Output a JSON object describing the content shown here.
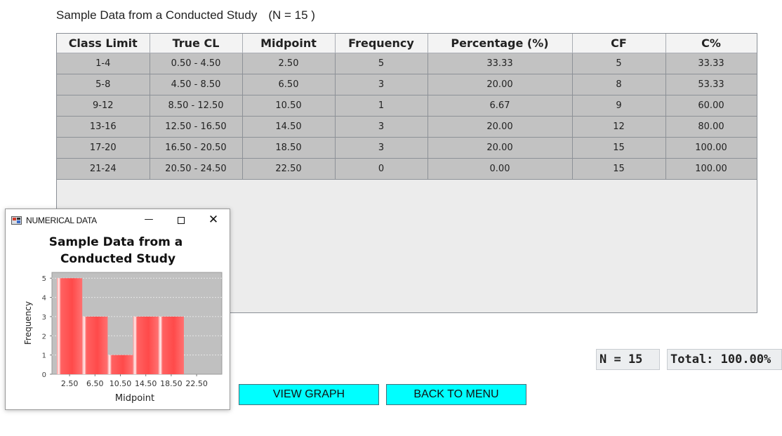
{
  "heading": {
    "title": "Sample Data from a Conducted Study",
    "n_label": "(N = 15 )"
  },
  "table": {
    "columns": [
      "Class Limit",
      "True CL",
      "Midpoint",
      "Frequency",
      "Percentage (%)",
      "CF",
      "C%"
    ],
    "rows": [
      [
        "1-4",
        "0.50 - 4.50",
        "2.50",
        "5",
        "33.33",
        "5",
        "33.33"
      ],
      [
        "5-8",
        "4.50 - 8.50",
        "6.50",
        "3",
        "20.00",
        "8",
        "53.33"
      ],
      [
        "9-12",
        "8.50 - 12.50",
        "10.50",
        "1",
        "6.67",
        "9",
        "60.00"
      ],
      [
        "13-16",
        "12.50 - 16.50",
        "14.50",
        "3",
        "20.00",
        "12",
        "80.00"
      ],
      [
        "17-20",
        "16.50 - 20.50",
        "18.50",
        "3",
        "20.00",
        "15",
        "100.00"
      ],
      [
        "21-24",
        "20.50 - 24.50",
        "22.50",
        "0",
        "0.00",
        "15",
        "100.00"
      ]
    ]
  },
  "stats": {
    "n": "N = 15",
    "total": "Total: 100.00%"
  },
  "buttons": {
    "view_graph": "VIEW GRAPH",
    "back_to_menu": "BACK TO MENU"
  },
  "popup": {
    "window_title": "NUMERICAL DATA",
    "icon": "java-app-icon",
    "controls": {
      "minimize": "—",
      "close": "✕"
    }
  },
  "colors": {
    "button": "#00ffff",
    "bar": "#ff5a5a",
    "plot_bg": "#c0c0c0",
    "cell_bg": "#c2c2c2"
  },
  "chart_data": {
    "type": "bar",
    "title": "Sample Data from a Conducted Study",
    "xlabel": "Midpoint",
    "ylabel": "Frequency",
    "categories": [
      "2.50",
      "6.50",
      "10.50",
      "14.50",
      "18.50",
      "22.50"
    ],
    "values": [
      5,
      3,
      1,
      3,
      3,
      0
    ],
    "ylim": [
      0,
      5.3
    ],
    "yticks": [
      0,
      1,
      2,
      3,
      4,
      5
    ],
    "grid": true,
    "legend": "none"
  }
}
